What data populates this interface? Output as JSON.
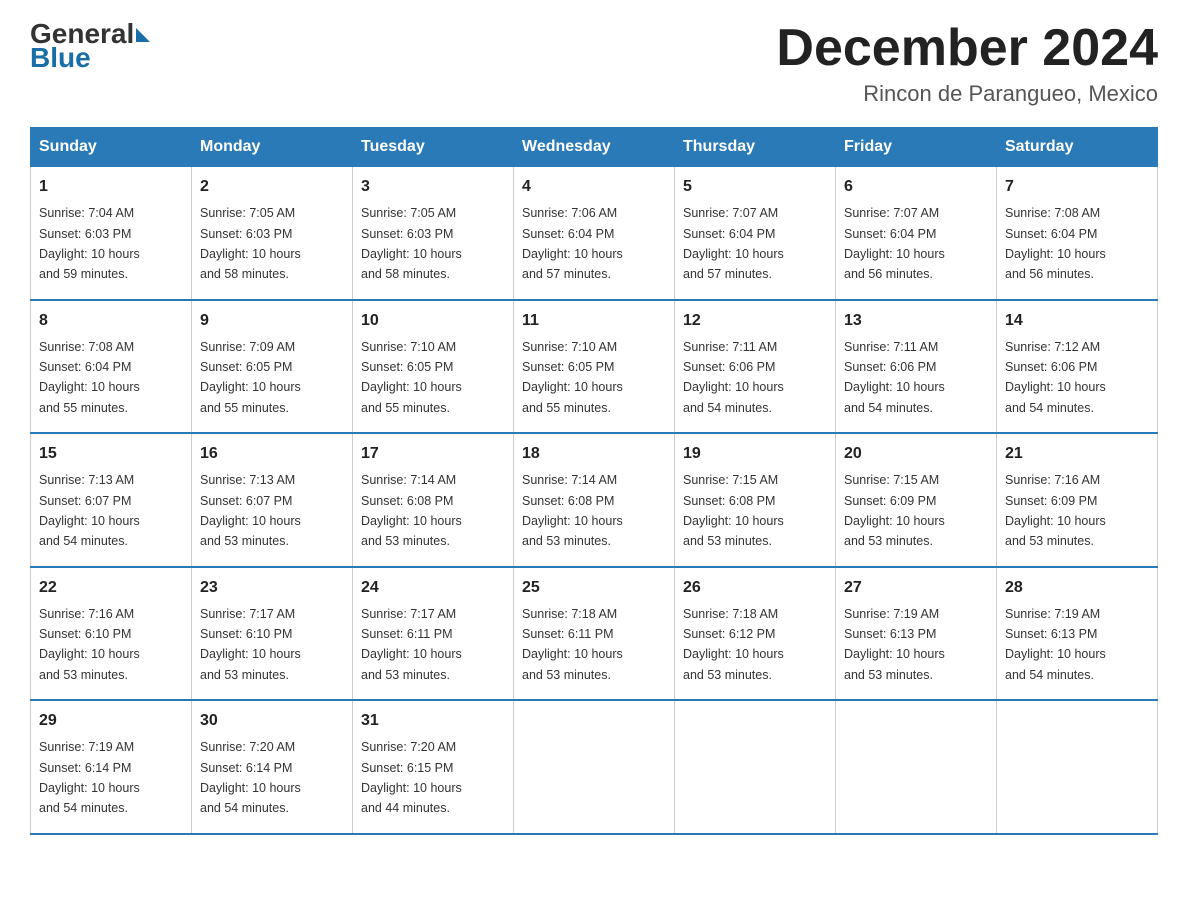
{
  "logo": {
    "general": "General",
    "blue": "Blue"
  },
  "header": {
    "month": "December 2024",
    "location": "Rincon de Parangueo, Mexico"
  },
  "days_of_week": [
    "Sunday",
    "Monday",
    "Tuesday",
    "Wednesday",
    "Thursday",
    "Friday",
    "Saturday"
  ],
  "weeks": [
    [
      {
        "day": "1",
        "sunrise": "7:04 AM",
        "sunset": "6:03 PM",
        "daylight": "10 hours and 59 minutes."
      },
      {
        "day": "2",
        "sunrise": "7:05 AM",
        "sunset": "6:03 PM",
        "daylight": "10 hours and 58 minutes."
      },
      {
        "day": "3",
        "sunrise": "7:05 AM",
        "sunset": "6:03 PM",
        "daylight": "10 hours and 58 minutes."
      },
      {
        "day": "4",
        "sunrise": "7:06 AM",
        "sunset": "6:04 PM",
        "daylight": "10 hours and 57 minutes."
      },
      {
        "day": "5",
        "sunrise": "7:07 AM",
        "sunset": "6:04 PM",
        "daylight": "10 hours and 57 minutes."
      },
      {
        "day": "6",
        "sunrise": "7:07 AM",
        "sunset": "6:04 PM",
        "daylight": "10 hours and 56 minutes."
      },
      {
        "day": "7",
        "sunrise": "7:08 AM",
        "sunset": "6:04 PM",
        "daylight": "10 hours and 56 minutes."
      }
    ],
    [
      {
        "day": "8",
        "sunrise": "7:08 AM",
        "sunset": "6:04 PM",
        "daylight": "10 hours and 55 minutes."
      },
      {
        "day": "9",
        "sunrise": "7:09 AM",
        "sunset": "6:05 PM",
        "daylight": "10 hours and 55 minutes."
      },
      {
        "day": "10",
        "sunrise": "7:10 AM",
        "sunset": "6:05 PM",
        "daylight": "10 hours and 55 minutes."
      },
      {
        "day": "11",
        "sunrise": "7:10 AM",
        "sunset": "6:05 PM",
        "daylight": "10 hours and 55 minutes."
      },
      {
        "day": "12",
        "sunrise": "7:11 AM",
        "sunset": "6:06 PM",
        "daylight": "10 hours and 54 minutes."
      },
      {
        "day": "13",
        "sunrise": "7:11 AM",
        "sunset": "6:06 PM",
        "daylight": "10 hours and 54 minutes."
      },
      {
        "day": "14",
        "sunrise": "7:12 AM",
        "sunset": "6:06 PM",
        "daylight": "10 hours and 54 minutes."
      }
    ],
    [
      {
        "day": "15",
        "sunrise": "7:13 AM",
        "sunset": "6:07 PM",
        "daylight": "10 hours and 54 minutes."
      },
      {
        "day": "16",
        "sunrise": "7:13 AM",
        "sunset": "6:07 PM",
        "daylight": "10 hours and 53 minutes."
      },
      {
        "day": "17",
        "sunrise": "7:14 AM",
        "sunset": "6:08 PM",
        "daylight": "10 hours and 53 minutes."
      },
      {
        "day": "18",
        "sunrise": "7:14 AM",
        "sunset": "6:08 PM",
        "daylight": "10 hours and 53 minutes."
      },
      {
        "day": "19",
        "sunrise": "7:15 AM",
        "sunset": "6:08 PM",
        "daylight": "10 hours and 53 minutes."
      },
      {
        "day": "20",
        "sunrise": "7:15 AM",
        "sunset": "6:09 PM",
        "daylight": "10 hours and 53 minutes."
      },
      {
        "day": "21",
        "sunrise": "7:16 AM",
        "sunset": "6:09 PM",
        "daylight": "10 hours and 53 minutes."
      }
    ],
    [
      {
        "day": "22",
        "sunrise": "7:16 AM",
        "sunset": "6:10 PM",
        "daylight": "10 hours and 53 minutes."
      },
      {
        "day": "23",
        "sunrise": "7:17 AM",
        "sunset": "6:10 PM",
        "daylight": "10 hours and 53 minutes."
      },
      {
        "day": "24",
        "sunrise": "7:17 AM",
        "sunset": "6:11 PM",
        "daylight": "10 hours and 53 minutes."
      },
      {
        "day": "25",
        "sunrise": "7:18 AM",
        "sunset": "6:11 PM",
        "daylight": "10 hours and 53 minutes."
      },
      {
        "day": "26",
        "sunrise": "7:18 AM",
        "sunset": "6:12 PM",
        "daylight": "10 hours and 53 minutes."
      },
      {
        "day": "27",
        "sunrise": "7:19 AM",
        "sunset": "6:13 PM",
        "daylight": "10 hours and 53 minutes."
      },
      {
        "day": "28",
        "sunrise": "7:19 AM",
        "sunset": "6:13 PM",
        "daylight": "10 hours and 54 minutes."
      }
    ],
    [
      {
        "day": "29",
        "sunrise": "7:19 AM",
        "sunset": "6:14 PM",
        "daylight": "10 hours and 54 minutes."
      },
      {
        "day": "30",
        "sunrise": "7:20 AM",
        "sunset": "6:14 PM",
        "daylight": "10 hours and 54 minutes."
      },
      {
        "day": "31",
        "sunrise": "7:20 AM",
        "sunset": "6:15 PM",
        "daylight": "10 hours and 44 minutes."
      },
      null,
      null,
      null,
      null
    ]
  ],
  "labels": {
    "sunrise": "Sunrise:",
    "sunset": "Sunset:",
    "daylight": "Daylight:"
  }
}
